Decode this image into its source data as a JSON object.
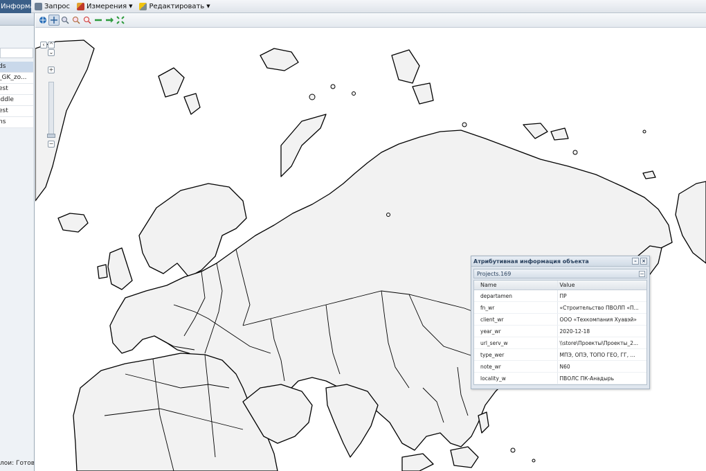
{
  "menubar": {
    "items": [
      {
        "label": "Информация",
        "icon": "info-icon",
        "active": true
      },
      {
        "label": "Запрос",
        "icon": "printer-icon"
      },
      {
        "label": "Измерения",
        "icon": "ruler-icon",
        "dropdown": true
      },
      {
        "label": "Редактировать",
        "icon": "pencil-icon",
        "dropdown": true
      }
    ]
  },
  "left_panel": {
    "layers": [
      "ds",
      "_GK_zo...",
      "est",
      "iddle",
      "est",
      "ns"
    ],
    "footer": "лои: Готово"
  },
  "toolbar": {
    "buttons": [
      "globe-icon",
      "pan-icon",
      "zoom-in-icon",
      "zoom-extent-icon",
      "zoom-out-icon",
      "back-arrow-icon",
      "forward-arrow-icon",
      "full-extent-icon"
    ]
  },
  "zoom_control": {
    "plus": "+",
    "minus": "−"
  },
  "info_window": {
    "title": "Атрибутивная информация объекта",
    "group": "Projects.169",
    "columns": {
      "name": "Name",
      "value": "Value"
    },
    "rows": [
      {
        "name": "departamen",
        "value": "ПР"
      },
      {
        "name": "fn_wr",
        "value": "«Строительство ПВОЛП «П..."
      },
      {
        "name": "client_wr",
        "value": "ООО «Техкомпания Хуавэй»"
      },
      {
        "name": "year_wr",
        "value": "2020-12-18"
      },
      {
        "name": "url_serv_w",
        "value": "\\\\store\\Проекты\\Проекты_2..."
      },
      {
        "name": "type_wer",
        "value": "МПЭ, ОПЭ, ТОПО ГЕО, ГГ, ..."
      },
      {
        "name": "note_wr",
        "value": "N60"
      },
      {
        "name": "locality_w",
        "value": "ПВОЛС ПК-Анадырь"
      }
    ]
  },
  "colors": {
    "menu_active": "#3b5f88",
    "land_fill": "#f2f2f2",
    "border": "#000000",
    "window_bg": "#dfe6ee"
  }
}
